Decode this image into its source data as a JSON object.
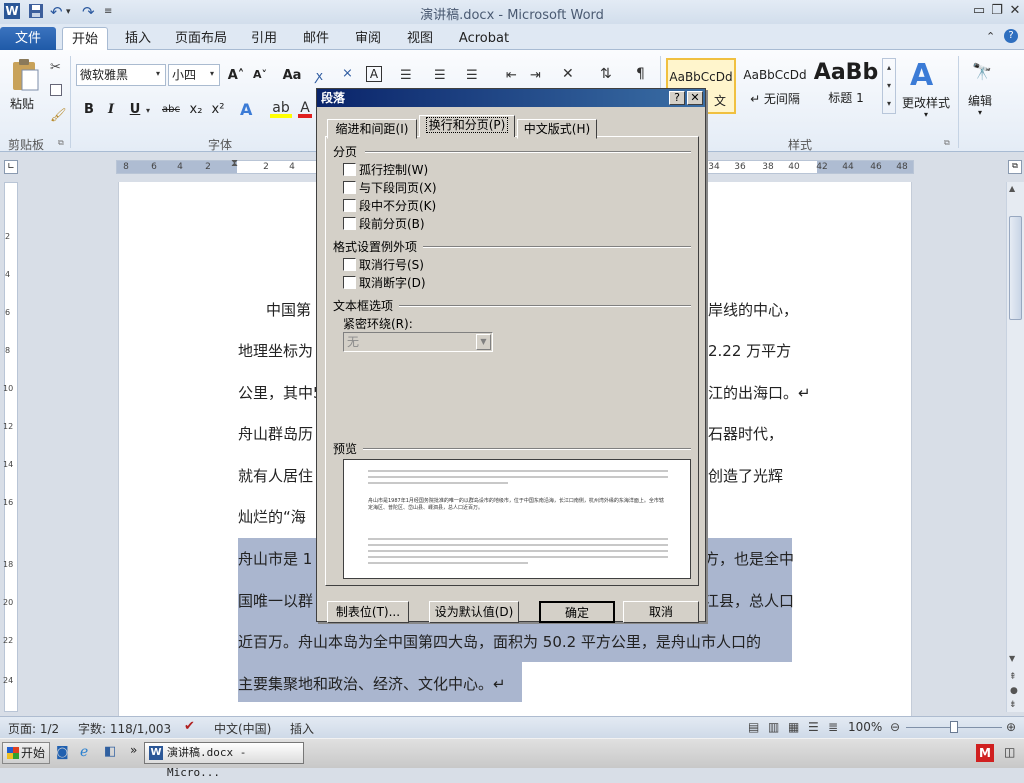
{
  "window": {
    "title": "演讲稿.docx - Microsoft Word"
  },
  "tabs": [
    "文件",
    "开始",
    "插入",
    "页面布局",
    "引用",
    "邮件",
    "审阅",
    "视图",
    "Acrobat"
  ],
  "ribbon": {
    "clipboard": {
      "paste": "粘贴",
      "label": "剪贴板"
    },
    "font": {
      "name": "微软雅黑",
      "size": "小四",
      "label": "字体",
      "bold": "B",
      "italic": "I",
      "underline": "U",
      "strike": "abc",
      "sub": "x₂",
      "sup": "x²",
      "grow": "A˄",
      "shrink": "A˅",
      "case": "Aa"
    },
    "styles": {
      "items": [
        "AaBbCcDd",
        "AaBbCcDd",
        "AaBb"
      ],
      "names": [
        "文",
        "↵ 无间隔",
        "标题 1"
      ],
      "change": "更改样式",
      "label": "样式"
    },
    "editing": {
      "label": "编辑"
    }
  },
  "ruler": {
    "ticks": [
      "8",
      "6",
      "4",
      "2",
      "2",
      "4",
      "34",
      "36",
      "38",
      "40",
      "42",
      "44",
      "46",
      "48"
    ]
  },
  "vruler": {
    "ticks": [
      "2",
      "4",
      "6",
      "8",
      "10",
      "12",
      "14",
      "16",
      "18",
      "20",
      "22",
      "24"
    ]
  },
  "document": {
    "lines": [
      "中国第",
      "地理坐标为",
      "公里，其中5",
      "舟山群岛历",
      "就有人居住",
      "灿烂的“海"
    ],
    "rlines": [
      "岸线的中心，",
      "2.22 万平方",
      "江的出海口。↵",
      "石器时代，",
      "创造了光辉"
    ],
    "sel_lines": [
      "舟山市是 1",
      "国唯一以群",
      "近百万。舟山本岛为全中国第四大岛，面积为 50.2 平方公里，是舟山市人口的",
      "主要集聚地和政治、经济、文化中心。↵"
    ],
    "sel_rlines": [
      "方，也是全中",
      "江县，总人口"
    ]
  },
  "dialog": {
    "title": "段落",
    "help": "?",
    "close": "✕",
    "tabs": [
      "缩进和间距(I)",
      "换行和分页(P)",
      "中文版式(H)"
    ],
    "section_pagination": "分页",
    "pagination": [
      "孤行控制(W)",
      "与下段同页(X)",
      "段中不分页(K)",
      "段前分页(B)"
    ],
    "section_format": "格式设置例外项",
    "format": [
      "取消行号(S)",
      "取消断字(D)"
    ],
    "section_textbox": "文本框选项",
    "tight_wrap_label": "紧密环绕(R):",
    "tight_wrap_value": "无",
    "section_preview": "预览",
    "preview_text": "舟山市是1987年1月经国务院批准的唯一的以群岛设市的地级市，位于中国东南沿海，长江口南侧，杭州湾外缘的东海洋面上。全市辖定海区、普陀区、岱山县、嵊泗县，总人口近百万。",
    "buttons": [
      "制表位(T)...",
      "设为默认值(D)",
      "确定",
      "取消"
    ]
  },
  "status": {
    "page": "页面: 1/2",
    "words": "字数: 118/1,003",
    "lang": "中文(中国)",
    "mode": "插入",
    "zoom": "100%"
  },
  "taskbar": {
    "start": "开始",
    "task": "演讲稿.docx - Micro..."
  }
}
